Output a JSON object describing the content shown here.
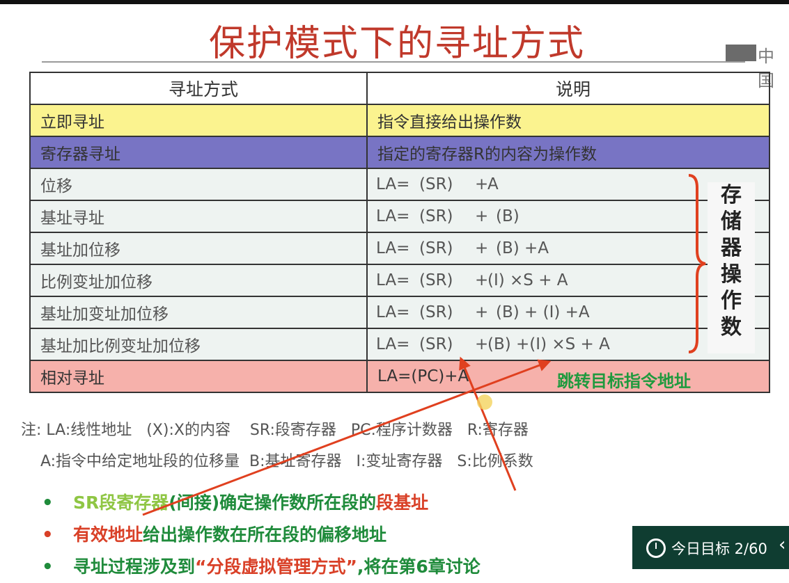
{
  "slide": {
    "title": "保护模式下的寻址方式",
    "logo_text": "中国"
  },
  "table": {
    "headers": [
      "寻址方式",
      "说明"
    ],
    "immediate": {
      "mode": "立即寻址",
      "desc": "指令直接给出操作数"
    },
    "register": {
      "mode": "寄存器寻址",
      "desc": "指定的寄存器R的内容为操作数"
    },
    "memory_rows": [
      {
        "mode": "位移",
        "la": "LA=",
        "sr": "(SR)",
        "plus": "+",
        "rest": "A"
      },
      {
        "mode": "基址寻址",
        "la": "LA=",
        "sr": "(SR)",
        "plus": "+",
        "rest": "(B)"
      },
      {
        "mode": "基址加位移",
        "la": "LA=",
        "sr": "(SR)",
        "plus": "+",
        "rest": "(B) +A"
      },
      {
        "mode": "比例变址加位移",
        "la": "LA=",
        "sr": "(SR)",
        "plus": "+",
        "rest": "(I) ×S  +  A"
      },
      {
        "mode": "基址加变址加位移",
        "la": "LA=",
        "sr": "(SR)",
        "plus": "+",
        "rest": "(B) + (I) +A"
      },
      {
        "mode": "基址加比例变址加位移",
        "la": "LA=",
        "sr": "(SR)",
        "plus": "+",
        "rest": "(B) +(I) ×S + A"
      }
    ],
    "memory_label": [
      "存",
      "储",
      "器",
      "操",
      "作",
      "数"
    ],
    "relative": {
      "mode": "相对寻址",
      "desc": "LA=(PC)+A"
    },
    "jump_label": "跳转目标指令地址"
  },
  "notes": {
    "line1": "注: LA:线性地址   (X):X的内容    SR:段寄存器   PC:程序计数器   R:寄存器",
    "line2": "    A:指令中给定地址段的位移量  B:基址寄存器   I:变址寄存器   S:比例系数"
  },
  "bullets": {
    "b1": {
      "part1": "SR段寄存器",
      "part2": "(间接)确定操作数所在段的",
      "part3": "段基址"
    },
    "b2": {
      "part1": "有效地址",
      "part2": "给出操作数在所在段的偏移地址"
    },
    "b3": {
      "part1": "寻址过程涉及到",
      "part2": "“分段虚拟管理方式”",
      "part3": ",将在第6章讨论"
    },
    "dot": "•"
  },
  "goal_widget": {
    "label": "今日目标 2/60",
    "chevron": "‹"
  },
  "colors": {
    "title": "#c0392b",
    "immediate_row": "#fbf38f",
    "register_row": "#7874c4",
    "relative_row": "#f6b1ab",
    "arrow": "#e0401f",
    "green": "#1f9a3e"
  }
}
